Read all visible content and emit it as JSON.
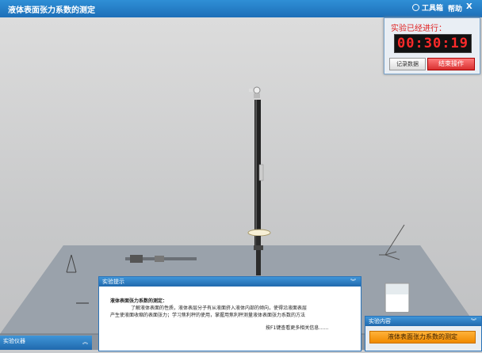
{
  "window": {
    "title": "液体表面张力系数的测定",
    "toolbox_label": "工具箱",
    "help_label": "帮助",
    "close_label": "X"
  },
  "timer": {
    "label": "实验已经进行：",
    "value": "00:30:19",
    "record_button": "记录数据",
    "end_button": "结束操作"
  },
  "hint_panel": {
    "header": "实验提示",
    "title": "液体表面张力系数的测定：",
    "line1": "了解液体表面的性质，液体表层分子有从液面挤入液体内部的倾向，使得沿液面表层",
    "line2": "产生使液面收缩的表面张力；学习焦利秤的使用，掌握用焦利秤测量液体表面张力系数的方法",
    "more": "按F1键查看更多相关信息……",
    "collapse_icon": "chevron-double-down"
  },
  "instruments_panel": {
    "header": "实验仪器",
    "expand_icon": "chevron-double-up"
  },
  "content_panel": {
    "header": "实验内容",
    "collapse_icon": "chevron-double-down",
    "item": "液体表面张力系数的测定"
  }
}
